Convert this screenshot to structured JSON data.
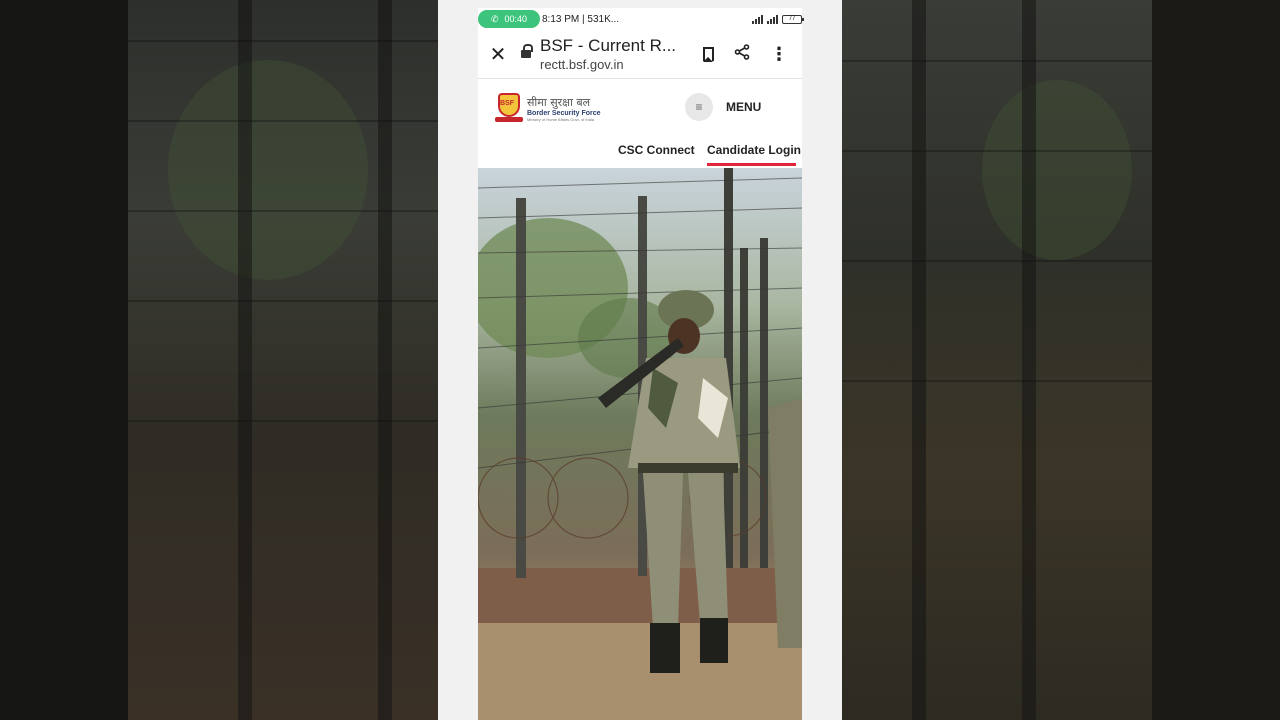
{
  "status_bar": {
    "call_timer": "00:40",
    "time_and_data": "8:13 PM | 531K...",
    "battery": "77"
  },
  "browser": {
    "page_title": "BSF - Current R...",
    "domain": "rectt.bsf.gov.in"
  },
  "site": {
    "logo_hindi": "सीमा सुरक्षा बल",
    "logo_english": "Border Security Force",
    "logo_ministry": "Ministry of Home Affairs Govt. of India",
    "logo_badge": "BSF",
    "menu_label": "MENU",
    "nav": {
      "csc": "CSC Connect",
      "login": "Candidate Login"
    }
  },
  "colors": {
    "accent": "#e0243a",
    "call_pill": "#3cc47c"
  }
}
